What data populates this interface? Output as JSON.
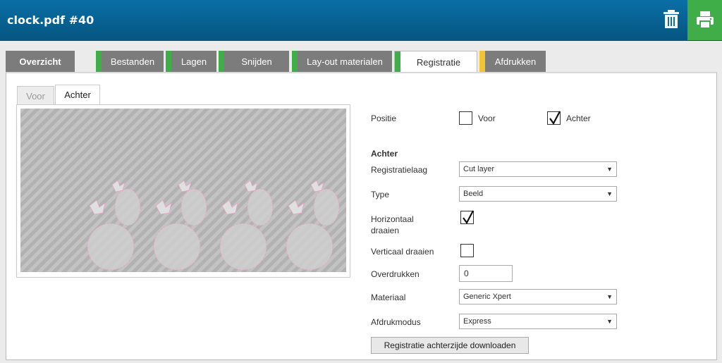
{
  "header": {
    "title": "clock.pdf #40",
    "delete_icon": "trash-icon",
    "print_icon": "printer-icon"
  },
  "colors": {
    "header": "#0a6fa6",
    "print": "#3fae49",
    "ok": "#3fae49",
    "warning": "#f2c432",
    "tab": "#7c7c7c"
  },
  "tabs": [
    {
      "label": "Overzicht",
      "status": "none"
    },
    {
      "label": "Bestanden",
      "status": "ok"
    },
    {
      "label": "Lagen",
      "status": "ok"
    },
    {
      "label": "Snijden",
      "status": "ok"
    },
    {
      "label": "Lay-out materialen",
      "status": "ok"
    },
    {
      "label": "Registratie",
      "status": "ok",
      "active": true
    },
    {
      "label": "Afdrukken",
      "status": "warning"
    }
  ],
  "side_tabs": {
    "front": "Voor",
    "back": "Achter",
    "active": "Achter"
  },
  "form": {
    "position": {
      "label": "Positie",
      "front": "Voor",
      "back": "Achter",
      "front_checked": false,
      "back_checked": true
    },
    "section_title": "Achter",
    "registration_layer": {
      "label": "Registratielaag",
      "value": "Cut layer"
    },
    "type": {
      "label": "Type",
      "value": "Beeld"
    },
    "flip_horizontal": {
      "label": "Horizontaal draaien",
      "checked": true
    },
    "flip_vertical": {
      "label": "Verticaal draaien",
      "checked": false
    },
    "overprint": {
      "label": "Overdrukken",
      "value": "0"
    },
    "material": {
      "label": "Materiaal",
      "value": "Generic Xpert"
    },
    "print_mode": {
      "label": "Afdrukmodus",
      "value": "Express"
    },
    "download_button": "Registratie achterzijde downloaden"
  }
}
